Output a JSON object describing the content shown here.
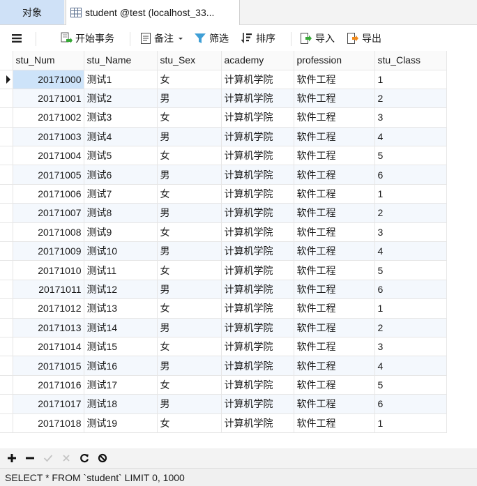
{
  "tabs": [
    {
      "label": "对象"
    },
    {
      "label": "student @test (localhost_33..."
    }
  ],
  "toolbar": {
    "menu_icon": "hamburger-menu-icon",
    "begin_transaction": "开始事务",
    "note": "备注",
    "filter": "筛选",
    "sort": "排序",
    "import": "导入",
    "export": "导出"
  },
  "table": {
    "columns": [
      "stu_Num",
      "stu_Name",
      "stu_Sex",
      "academy",
      "profession",
      "stu_Class"
    ],
    "rows": [
      [
        "20171000",
        "测试1",
        "女",
        "计算机学院",
        "软件工程",
        "1"
      ],
      [
        "20171001",
        "测试2",
        "男",
        "计算机学院",
        "软件工程",
        "2"
      ],
      [
        "20171002",
        "测试3",
        "女",
        "计算机学院",
        "软件工程",
        "3"
      ],
      [
        "20171003",
        "测试4",
        "男",
        "计算机学院",
        "软件工程",
        "4"
      ],
      [
        "20171004",
        "测试5",
        "女",
        "计算机学院",
        "软件工程",
        "5"
      ],
      [
        "20171005",
        "测试6",
        "男",
        "计算机学院",
        "软件工程",
        "6"
      ],
      [
        "20171006",
        "测试7",
        "女",
        "计算机学院",
        "软件工程",
        "1"
      ],
      [
        "20171007",
        "测试8",
        "男",
        "计算机学院",
        "软件工程",
        "2"
      ],
      [
        "20171008",
        "测试9",
        "女",
        "计算机学院",
        "软件工程",
        "3"
      ],
      [
        "20171009",
        "测试10",
        "男",
        "计算机学院",
        "软件工程",
        "4"
      ],
      [
        "20171010",
        "测试11",
        "女",
        "计算机学院",
        "软件工程",
        "5"
      ],
      [
        "20171011",
        "测试12",
        "男",
        "计算机学院",
        "软件工程",
        "6"
      ],
      [
        "20171012",
        "测试13",
        "女",
        "计算机学院",
        "软件工程",
        "1"
      ],
      [
        "20171013",
        "测试14",
        "男",
        "计算机学院",
        "软件工程",
        "2"
      ],
      [
        "20171014",
        "测试15",
        "女",
        "计算机学院",
        "软件工程",
        "3"
      ],
      [
        "20171015",
        "测试16",
        "男",
        "计算机学院",
        "软件工程",
        "4"
      ],
      [
        "20171016",
        "测试17",
        "女",
        "计算机学院",
        "软件工程",
        "5"
      ],
      [
        "20171017",
        "测试18",
        "男",
        "计算机学院",
        "软件工程",
        "6"
      ],
      [
        "20171018",
        "测试19",
        "女",
        "计算机学院",
        "软件工程",
        "1"
      ]
    ],
    "selected_row": 0
  },
  "bottom_buttons": [
    {
      "name": "add-record-button",
      "icon": "plus-icon"
    },
    {
      "name": "delete-record-button",
      "icon": "minus-icon"
    },
    {
      "name": "apply-changes-button",
      "icon": "check-icon"
    },
    {
      "name": "discard-changes-button",
      "icon": "x-icon"
    },
    {
      "name": "refresh-button",
      "icon": "refresh-icon"
    },
    {
      "name": "stop-button",
      "icon": "stop-icon"
    }
  ],
  "status": {
    "query": "SELECT * FROM `student` LIMIT 0, 1000"
  },
  "colors": {
    "selected_tab": "#cfe1f7",
    "selected_cell": "#cde3f9",
    "alt_row": "#f4f8fd",
    "toolbar_green": "#36a836"
  }
}
